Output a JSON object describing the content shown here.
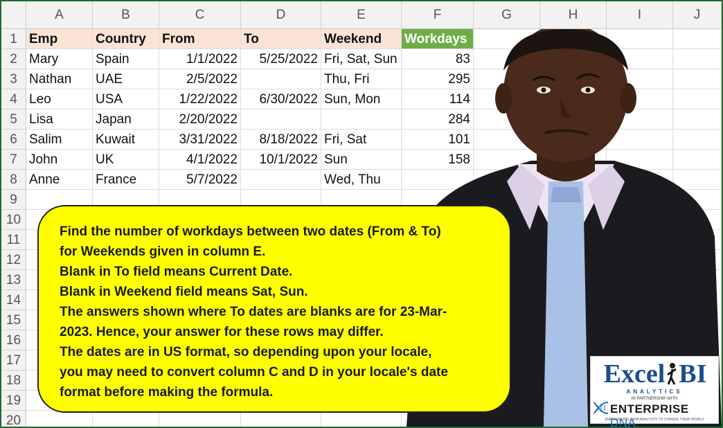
{
  "columns": [
    "A",
    "B",
    "C",
    "D",
    "E",
    "F",
    "G",
    "H",
    "I",
    "J"
  ],
  "rows": [
    "1",
    "2",
    "3",
    "4",
    "5",
    "6",
    "7",
    "8",
    "9",
    "10",
    "11",
    "12",
    "13",
    "14",
    "15",
    "16",
    "17",
    "18",
    "19",
    "20"
  ],
  "table": {
    "headers": [
      "Emp",
      "Country",
      "From",
      "To",
      "Weekend",
      "Workdays"
    ],
    "rows": [
      [
        "Mary",
        "Spain",
        "1/1/2022",
        "5/25/2022",
        "Fri, Sat, Sun",
        "83"
      ],
      [
        "Nathan",
        "UAE",
        "2/5/2022",
        "",
        "Thu, Fri",
        "295"
      ],
      [
        "Leo",
        "USA",
        "1/22/2022",
        "6/30/2022",
        "Sun, Mon",
        "114"
      ],
      [
        "Lisa",
        "Japan",
        "2/20/2022",
        "",
        "",
        "284"
      ],
      [
        "Salim",
        "Kuwait",
        "3/31/2022",
        "8/18/2022",
        "Fri, Sat",
        "101"
      ],
      [
        "John",
        "UK",
        "4/1/2022",
        "10/1/2022",
        "Sun",
        "158"
      ],
      [
        "Anne",
        "France",
        "5/7/2022",
        "",
        "Wed, Thu",
        ""
      ]
    ]
  },
  "callout": {
    "lines": [
      "Find the number of workdays between two dates (From & To)",
      "for Weekends given in column E.",
      "Blank in To field means Current Date.",
      "Blank in Weekend field means Sat, Sun.",
      "The answers shown where To dates are blanks are for 23-Mar-",
      "2023. Hence, your answer for these rows may differ.",
      "The dates are in US format, so depending upon your locale,",
      "you may need to convert column C and D in your locale's date",
      "format before making the formula."
    ]
  },
  "logo": {
    "brand": "Excel",
    "brand_suffix": "BI",
    "sub": "ANALYTICS",
    "partnership": "IN PARTNERSHIP WITH",
    "partner": "ENTERPRISE",
    "partner_suffix": "DNA",
    "tagline": "EMPOWERING DATA ANALYSTS TO CHANGE THEIR WORLD"
  },
  "colors": {
    "header_fill": "#fbe4d6",
    "workdays_fill": "#70ad47",
    "callout_fill": "#ffff00",
    "frame": "#1f6b33"
  }
}
